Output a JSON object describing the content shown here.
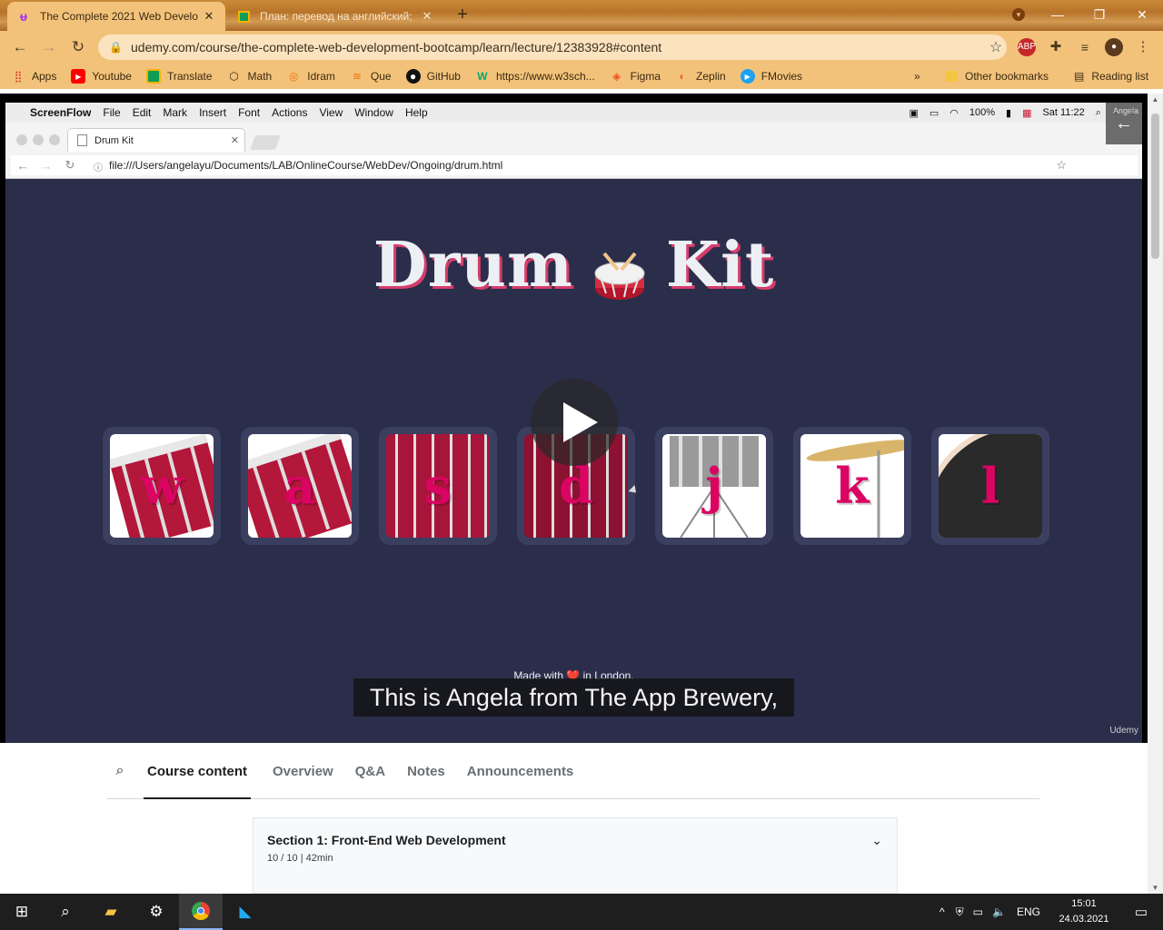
{
  "browser": {
    "tabs": [
      {
        "title": "The Complete 2021 Web Develo",
        "favicon": "udemy-icon",
        "active": true
      },
      {
        "title": "План: перевод на английский;",
        "favicon": "doc-icon",
        "active": false
      }
    ],
    "url": "udemy.com/course/the-complete-web-development-bootcamp/learn/lecture/12383928#content",
    "bookmarks": [
      "Apps",
      "Youtube",
      "Translate",
      "Math",
      "Idram",
      "Que",
      "GitHub",
      "https://www.w3sch...",
      "Figma",
      "Zeplin",
      "FMovies"
    ],
    "bookmarks_overflow": "»",
    "other_bookmarks": "Other bookmarks",
    "reading_list": "Reading list"
  },
  "video": {
    "mac_menu": [
      "ScreenFlow",
      "File",
      "Edit",
      "Mark",
      "Insert",
      "Font",
      "Actions",
      "View",
      "Window",
      "Help"
    ],
    "mac_status": {
      "battery": "100%",
      "clock": "Sat 11:22"
    },
    "inner_tab_title": "Drum Kit",
    "inner_url": "file:///Users/angelayu/Documents/LAB/OnlineCourse/WebDev/Ongoing/drum.html",
    "page_title_left": "Drum",
    "page_title_right": "Kit",
    "drum_letters": [
      "w",
      "a",
      "s",
      "d",
      "j",
      "k",
      "l"
    ],
    "footer_text": "Made with ❤️ in London.",
    "caption": "This is Angela from The App Brewery,",
    "watermark": "Udemy",
    "ext_label": "Angela"
  },
  "course": {
    "tabs": [
      "Course content",
      "Overview",
      "Q&A",
      "Notes",
      "Announcements"
    ],
    "active_tab": "Course content",
    "section_title": "Section 1: Front-End Web Development",
    "section_meta": "10 / 10 | 42min"
  },
  "taskbar": {
    "lang": "ENG",
    "time": "15:01",
    "date": "24.03.2021"
  },
  "colors": {
    "page_bg": "#2b2e4a",
    "drum_letter": "#da0463",
    "title_shadow": "#d63d6a",
    "chrome_theme": "#f3c27a"
  }
}
